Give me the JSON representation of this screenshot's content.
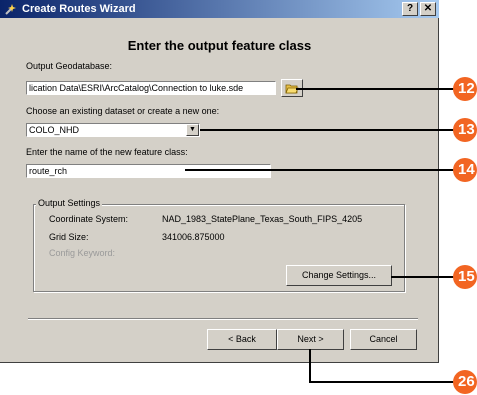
{
  "window": {
    "title": "Create Routes Wizard",
    "help_btn": "?",
    "close_btn": "✕"
  },
  "heading": "Enter the output feature class",
  "output_gdb": {
    "label": "Output Geodatabase:",
    "value": "lication Data\\ESRI\\ArcCatalog\\Connection to luke.sde"
  },
  "dataset": {
    "label": "Choose an existing dataset or create a new one:",
    "value": "COLO_NHD"
  },
  "feature_class": {
    "label": "Enter the name of the new feature class:",
    "value": "route_rch"
  },
  "output_settings": {
    "legend": "Output Settings",
    "coord_label": "Coordinate System:",
    "coord_value": "NAD_1983_StatePlane_Texas_South_FIPS_4205",
    "grid_label": "Grid Size:",
    "grid_value": "341006.875000",
    "config_label": "Config Keyword:",
    "change_btn": "Change Settings..."
  },
  "nav": {
    "back": "< Back",
    "next": "Next >",
    "cancel": "Cancel"
  },
  "callouts": [
    "12",
    "13",
    "14",
    "15",
    "26"
  ],
  "colors": {
    "callout": "#f26522",
    "titlebar": "#0a246a"
  }
}
